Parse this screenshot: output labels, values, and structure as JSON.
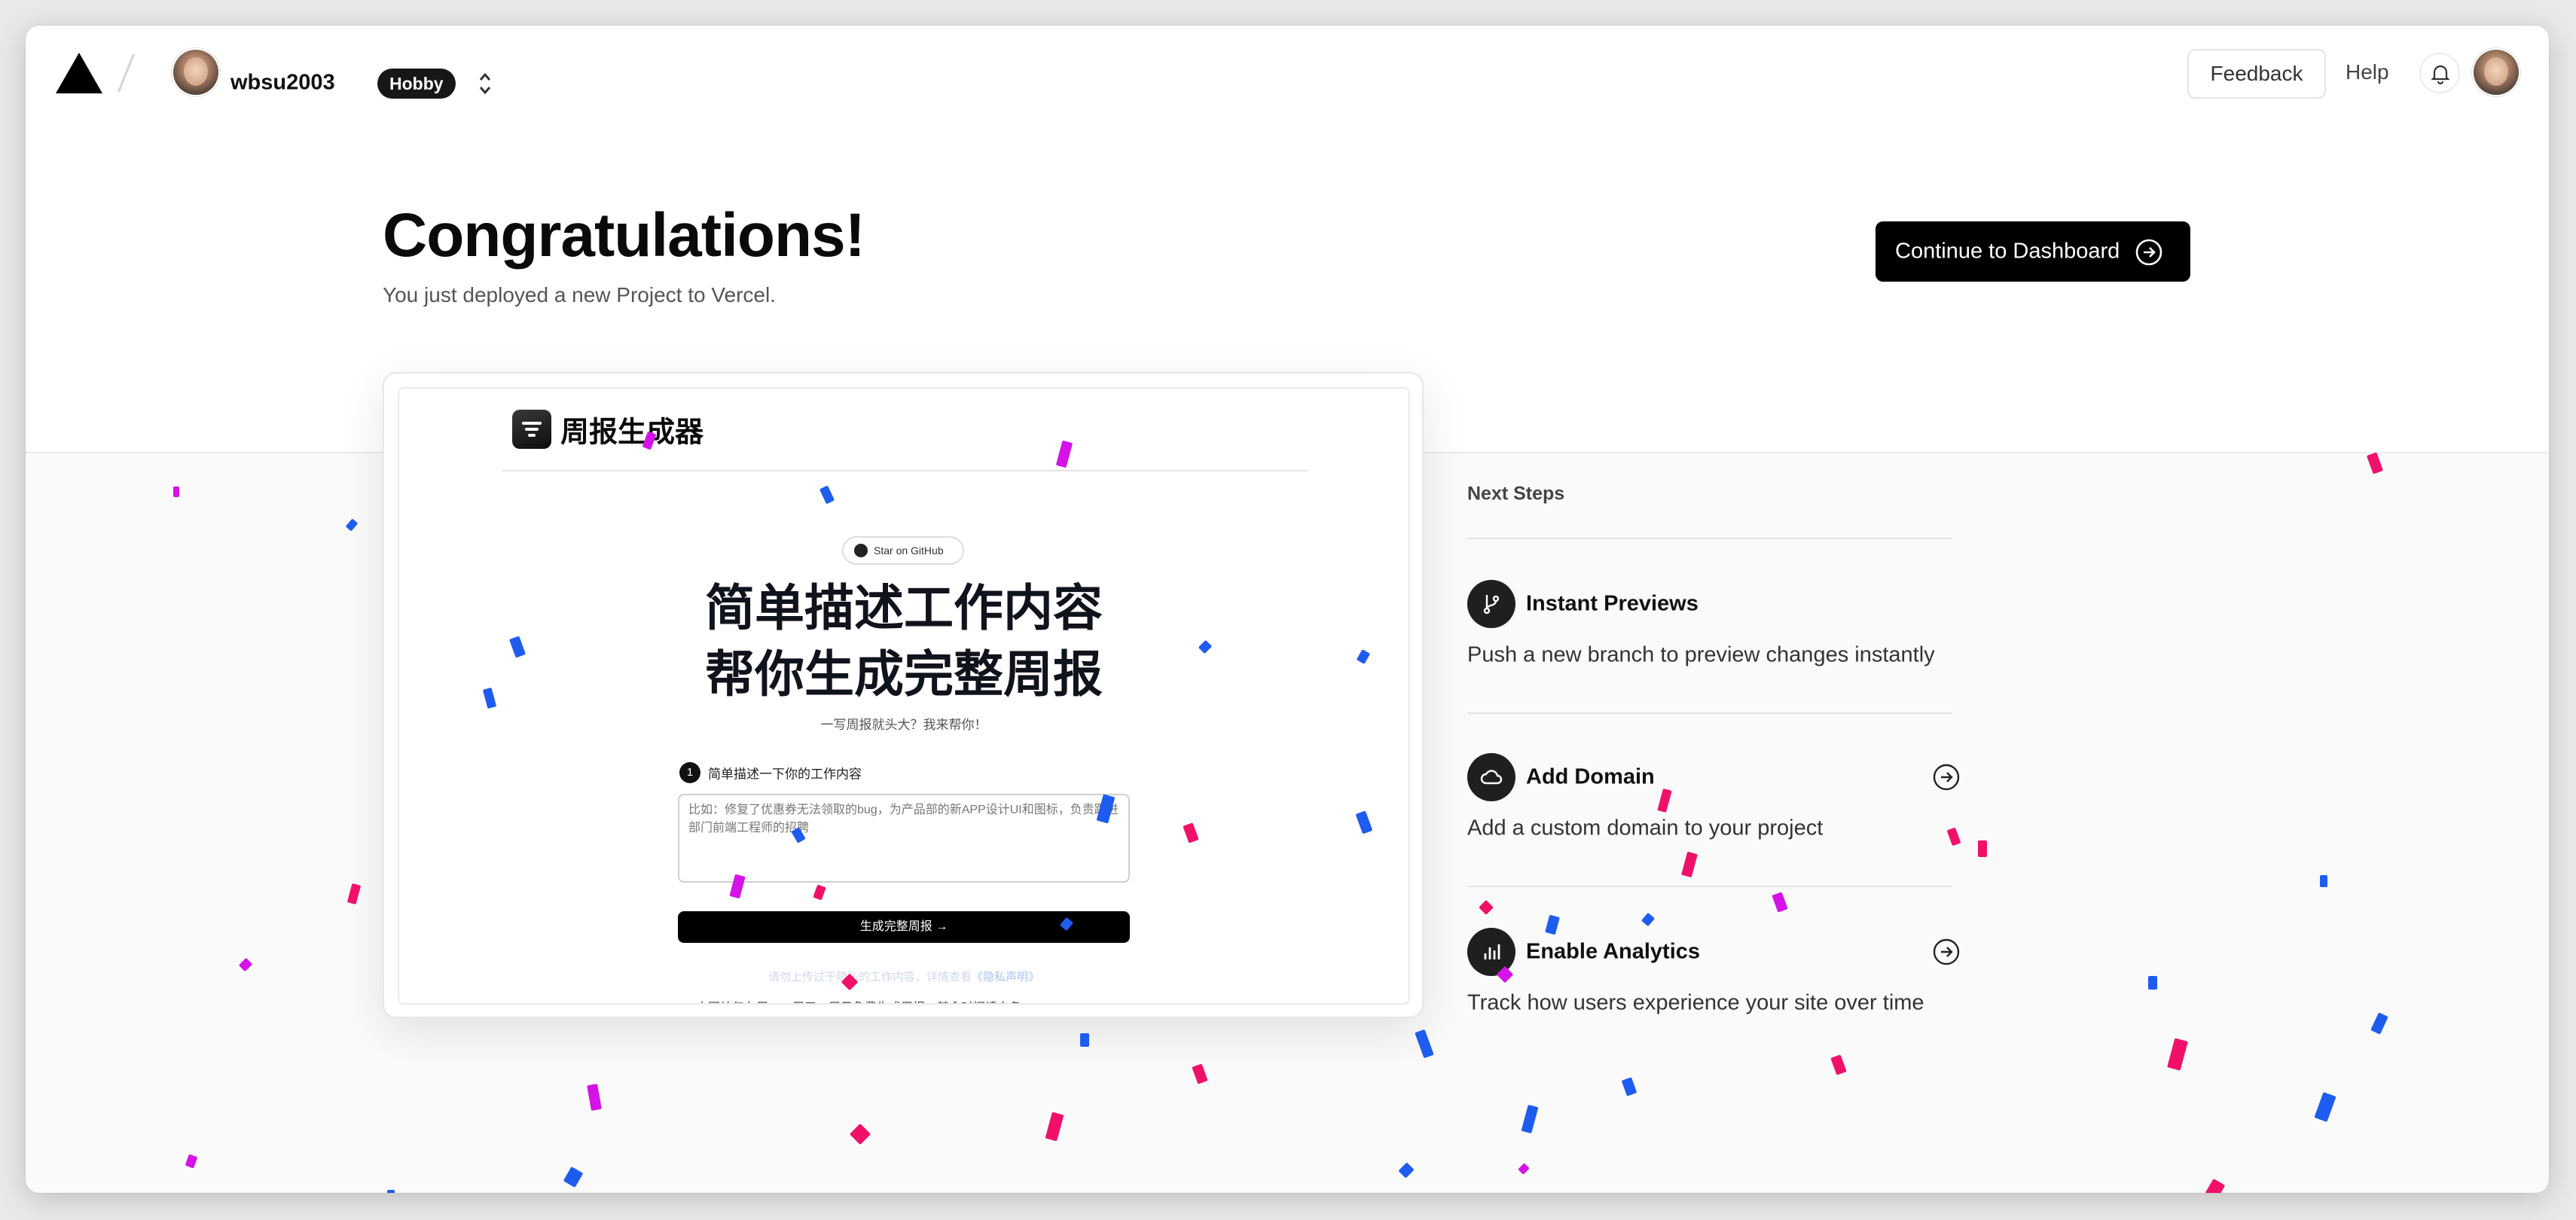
{
  "header": {
    "username": "wbsu2003",
    "plan": "Hobby",
    "feedback_label": "Feedback",
    "help_label": "Help"
  },
  "hero": {
    "title": "Congratulations!",
    "subtitle": "You just deployed a new Project to Vercel.",
    "cta_label": "Continue to Dashboard"
  },
  "preview": {
    "app_title": "周报生成器",
    "github_label": "Star on GitHub",
    "headline_1": "简单描述工作内容",
    "headline_2": "帮你生成完整周报",
    "tagline": "一写周报就头大？我来帮你！",
    "step_number": "1",
    "step_label": "简单描述一下你的工作内容",
    "textarea_placeholder": "比如：修复了优惠券无法领取的bug，为产品部的新APP设计UI和图标，负责跟进部门前端工程师的招聘",
    "generate_label": "生成完整周报 →",
    "privacy_text": "请勿上传过于隐私的工作内容，详情查看",
    "privacy_link": "《隐私声明》",
    "footer_text": "本网站仅在周一、周五、周日免费生成周报，其余时间请自备 OpenAI API Key"
  },
  "next_steps": {
    "title": "Next Steps",
    "items": [
      {
        "name": "Instant Previews",
        "desc": "Push a new branch to preview changes instantly",
        "icon": "branch-icon"
      },
      {
        "name": "Add Domain",
        "desc": "Add a custom domain to your project",
        "icon": "cloud-icon"
      },
      {
        "name": "Enable Analytics",
        "desc": "Track how users experience your site over time",
        "icon": "bar-chart-icon"
      }
    ]
  },
  "colors": {
    "confetti_blue": "#1e5cf0",
    "confetti_pink": "#f0106a",
    "confetti_magenta": "#d512e8",
    "primary": "#000000"
  }
}
